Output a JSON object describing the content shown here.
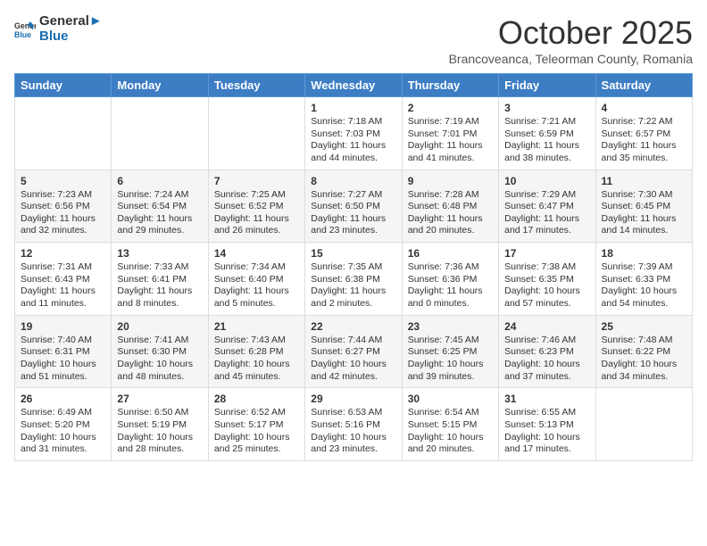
{
  "header": {
    "logo_general": "General",
    "logo_blue": "Blue",
    "month_title": "October 2025",
    "subtitle": "Brancoveanca, Teleorman County, Romania"
  },
  "days_of_week": [
    "Sunday",
    "Monday",
    "Tuesday",
    "Wednesday",
    "Thursday",
    "Friday",
    "Saturday"
  ],
  "weeks": [
    [
      {
        "day": "",
        "content": ""
      },
      {
        "day": "",
        "content": ""
      },
      {
        "day": "",
        "content": ""
      },
      {
        "day": "1",
        "content": "Sunrise: 7:18 AM\nSunset: 7:03 PM\nDaylight: 11 hours and 44 minutes."
      },
      {
        "day": "2",
        "content": "Sunrise: 7:19 AM\nSunset: 7:01 PM\nDaylight: 11 hours and 41 minutes."
      },
      {
        "day": "3",
        "content": "Sunrise: 7:21 AM\nSunset: 6:59 PM\nDaylight: 11 hours and 38 minutes."
      },
      {
        "day": "4",
        "content": "Sunrise: 7:22 AM\nSunset: 6:57 PM\nDaylight: 11 hours and 35 minutes."
      }
    ],
    [
      {
        "day": "5",
        "content": "Sunrise: 7:23 AM\nSunset: 6:56 PM\nDaylight: 11 hours and 32 minutes."
      },
      {
        "day": "6",
        "content": "Sunrise: 7:24 AM\nSunset: 6:54 PM\nDaylight: 11 hours and 29 minutes."
      },
      {
        "day": "7",
        "content": "Sunrise: 7:25 AM\nSunset: 6:52 PM\nDaylight: 11 hours and 26 minutes."
      },
      {
        "day": "8",
        "content": "Sunrise: 7:27 AM\nSunset: 6:50 PM\nDaylight: 11 hours and 23 minutes."
      },
      {
        "day": "9",
        "content": "Sunrise: 7:28 AM\nSunset: 6:48 PM\nDaylight: 11 hours and 20 minutes."
      },
      {
        "day": "10",
        "content": "Sunrise: 7:29 AM\nSunset: 6:47 PM\nDaylight: 11 hours and 17 minutes."
      },
      {
        "day": "11",
        "content": "Sunrise: 7:30 AM\nSunset: 6:45 PM\nDaylight: 11 hours and 14 minutes."
      }
    ],
    [
      {
        "day": "12",
        "content": "Sunrise: 7:31 AM\nSunset: 6:43 PM\nDaylight: 11 hours and 11 minutes."
      },
      {
        "day": "13",
        "content": "Sunrise: 7:33 AM\nSunset: 6:41 PM\nDaylight: 11 hours and 8 minutes."
      },
      {
        "day": "14",
        "content": "Sunrise: 7:34 AM\nSunset: 6:40 PM\nDaylight: 11 hours and 5 minutes."
      },
      {
        "day": "15",
        "content": "Sunrise: 7:35 AM\nSunset: 6:38 PM\nDaylight: 11 hours and 2 minutes."
      },
      {
        "day": "16",
        "content": "Sunrise: 7:36 AM\nSunset: 6:36 PM\nDaylight: 11 hours and 0 minutes."
      },
      {
        "day": "17",
        "content": "Sunrise: 7:38 AM\nSunset: 6:35 PM\nDaylight: 10 hours and 57 minutes."
      },
      {
        "day": "18",
        "content": "Sunrise: 7:39 AM\nSunset: 6:33 PM\nDaylight: 10 hours and 54 minutes."
      }
    ],
    [
      {
        "day": "19",
        "content": "Sunrise: 7:40 AM\nSunset: 6:31 PM\nDaylight: 10 hours and 51 minutes."
      },
      {
        "day": "20",
        "content": "Sunrise: 7:41 AM\nSunset: 6:30 PM\nDaylight: 10 hours and 48 minutes."
      },
      {
        "day": "21",
        "content": "Sunrise: 7:43 AM\nSunset: 6:28 PM\nDaylight: 10 hours and 45 minutes."
      },
      {
        "day": "22",
        "content": "Sunrise: 7:44 AM\nSunset: 6:27 PM\nDaylight: 10 hours and 42 minutes."
      },
      {
        "day": "23",
        "content": "Sunrise: 7:45 AM\nSunset: 6:25 PM\nDaylight: 10 hours and 39 minutes."
      },
      {
        "day": "24",
        "content": "Sunrise: 7:46 AM\nSunset: 6:23 PM\nDaylight: 10 hours and 37 minutes."
      },
      {
        "day": "25",
        "content": "Sunrise: 7:48 AM\nSunset: 6:22 PM\nDaylight: 10 hours and 34 minutes."
      }
    ],
    [
      {
        "day": "26",
        "content": "Sunrise: 6:49 AM\nSunset: 5:20 PM\nDaylight: 10 hours and 31 minutes."
      },
      {
        "day": "27",
        "content": "Sunrise: 6:50 AM\nSunset: 5:19 PM\nDaylight: 10 hours and 28 minutes."
      },
      {
        "day": "28",
        "content": "Sunrise: 6:52 AM\nSunset: 5:17 PM\nDaylight: 10 hours and 25 minutes."
      },
      {
        "day": "29",
        "content": "Sunrise: 6:53 AM\nSunset: 5:16 PM\nDaylight: 10 hours and 23 minutes."
      },
      {
        "day": "30",
        "content": "Sunrise: 6:54 AM\nSunset: 5:15 PM\nDaylight: 10 hours and 20 minutes."
      },
      {
        "day": "31",
        "content": "Sunrise: 6:55 AM\nSunset: 5:13 PM\nDaylight: 10 hours and 17 minutes."
      },
      {
        "day": "",
        "content": ""
      }
    ]
  ]
}
